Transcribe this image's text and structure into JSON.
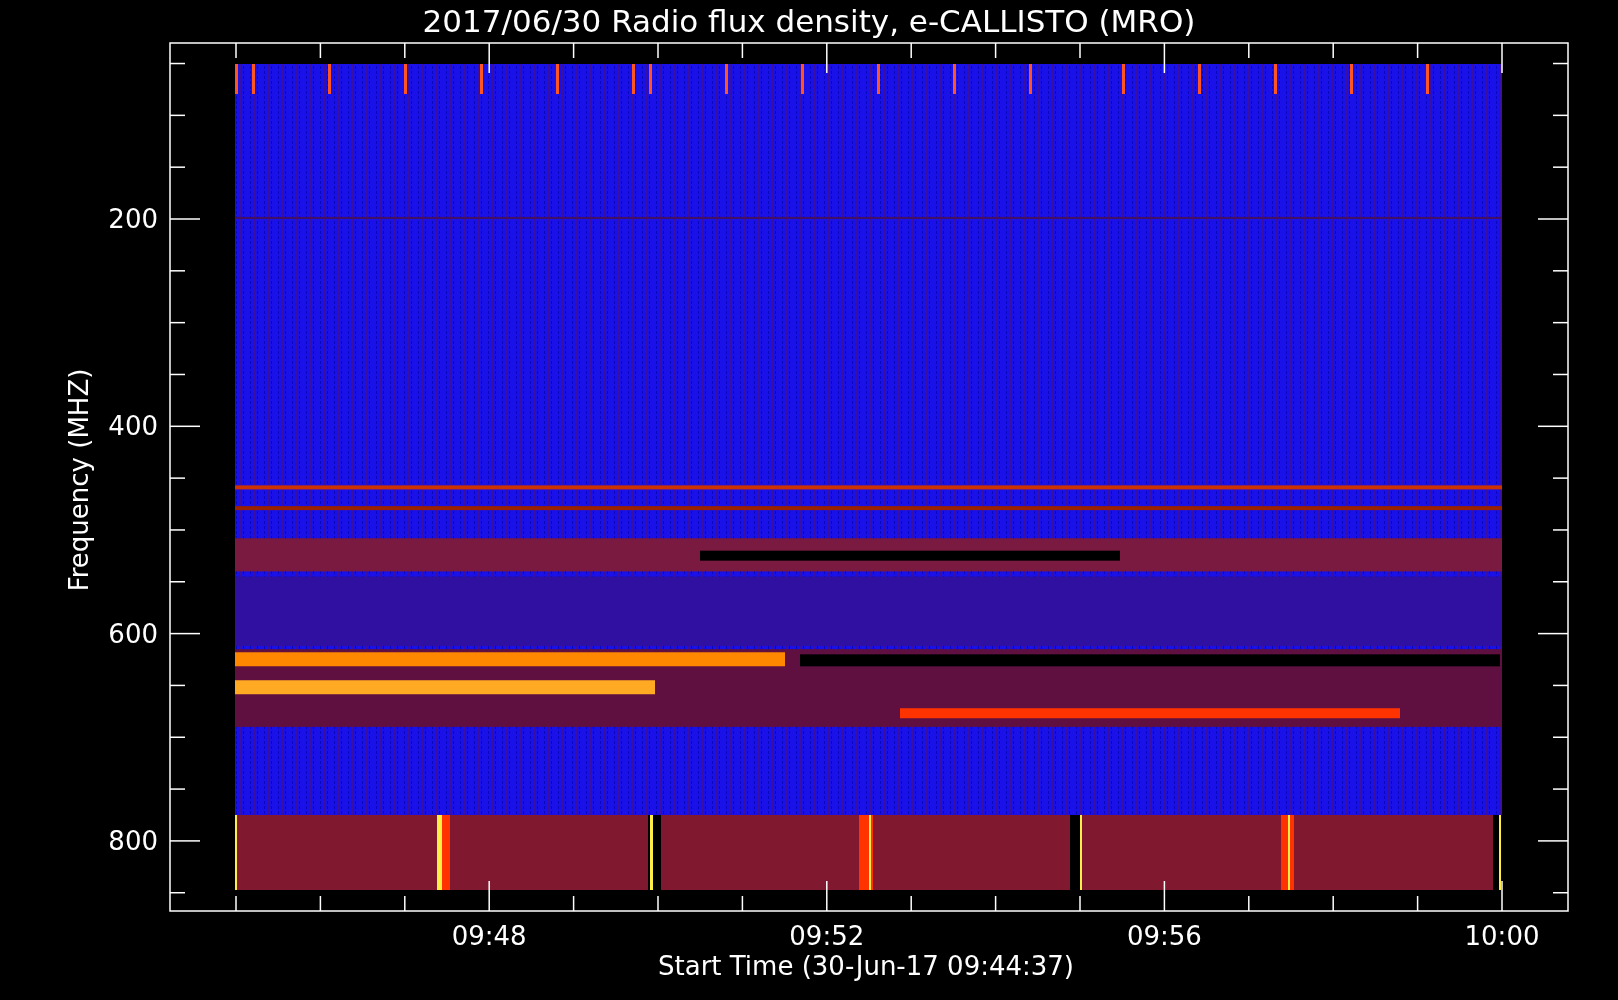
{
  "plot": {
    "title": "2017/06/30  Radio flux density, e-CALLISTO (MRO)",
    "ylabel": "Frequency (MHZ)",
    "xlabel": "Start Time (30-Jun-17 09:44:37)",
    "yticks": [
      "200",
      "400",
      "600",
      "800"
    ],
    "xticks": [
      "09:48",
      "09:52",
      "09:56",
      "10:00"
    ]
  }
}
